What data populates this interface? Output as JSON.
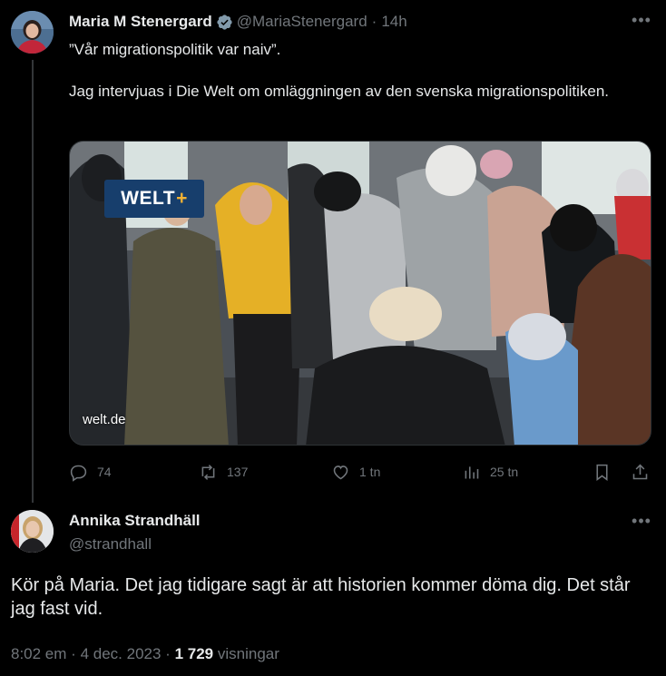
{
  "tweet": {
    "author_name": "Maria M Stenergard",
    "handle": "@MariaStenergard",
    "separator": "·",
    "time": "14h",
    "more_label": "•••",
    "text_line1": "”Vår migrationspolitik var naiv”.",
    "text_line2": "Jag intervjuas i Die Welt om omläggningen av den svenska migrationspolitiken.",
    "card": {
      "badge_text": "WELT",
      "badge_plus": "+",
      "domain": "welt.de"
    },
    "actions": {
      "replies": "74",
      "retweets": "137",
      "likes": "1 tn",
      "views": "25 tn"
    }
  },
  "reply": {
    "author_name": "Annika Strandhäll",
    "handle": "@strandhall",
    "more_label": "•••",
    "text": "Kör på Maria. Det jag tidigare sagt är att historien kommer döma dig. Det står jag fast vid.",
    "time": "8:02 em",
    "dot": "·",
    "date": "4 dec. 2023",
    "view_count": "1 729",
    "views_label": "visningar"
  },
  "colors": {
    "background": "#000000",
    "text": "#e7e9ea",
    "muted": "#71767b",
    "verified": "#829aab",
    "welt_blue": "#173e6c",
    "welt_plus": "#f2b233"
  }
}
